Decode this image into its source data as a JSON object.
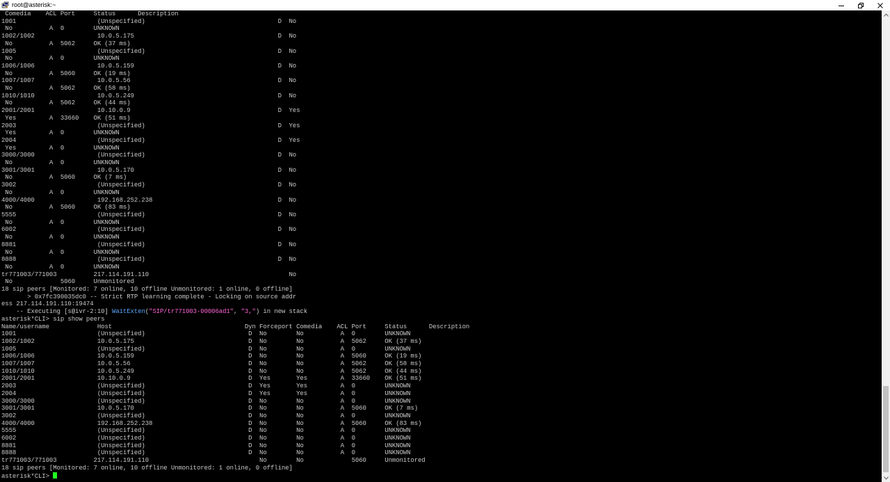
{
  "window": {
    "title": "root@asterisk:~",
    "icon": "putty-terminal-icon",
    "minimize_icon": "minimize-icon",
    "maximize_icon": "restore-icon",
    "close_icon": "close-icon"
  },
  "colors": {
    "background": "#000000",
    "text": "#c8c8c8",
    "application": "#5aa8ff",
    "string": "#ff66d6",
    "cursor": "#22ff22"
  },
  "terminal": {
    "lines": [
      " Comedia    ACL Port     Status      Description",
      "1001                      (Unspecified)                                    D  No",
      " No          A  0        UNKNOWN",
      "1002/1002                 10.0.5.175                                       D  No",
      " No          A  5062     OK (37 ms)",
      "1005                      (Unspecified)                                    D  No",
      " No          A  0        UNKNOWN",
      "1006/1006                 10.0.5.159                                       D  No",
      " No          A  5060     OK (19 ms)",
      "1007/1007                 10.0.5.56                                        D  No",
      " No          A  5062     OK (58 ms)",
      "1010/1010                 10.0.5.249                                       D  No",
      " No          A  5062     OK (44 ms)",
      "2001/2001                 10.10.0.9                                        D  Yes",
      " Yes         A  33660    OK (51 ms)",
      "2003                      (Unspecified)                                    D  Yes",
      " Yes         A  0        UNKNOWN",
      "2004                      (Unspecified)                                    D  Yes",
      " Yes         A  0        UNKNOWN",
      "3000/3000                 (Unspecified)                                    D  No",
      " No          A  0        UNKNOWN",
      "3001/3001                 10.0.5.170                                       D  No",
      " No          A  5060     OK (7 ms)",
      "3002                      (Unspecified)                                    D  No",
      " No          A  0        UNKNOWN",
      "4000/4000                 192.168.252.238                                  D  No",
      " No          A  5060     OK (83 ms)",
      "5555                      (Unspecified)                                    D  No",
      " No          A  0        UNKNOWN",
      "6002                      (Unspecified)                                    D  No",
      " No          A  0        UNKNOWN",
      "8881                      (Unspecified)                                    D  No",
      " No          A  0        UNKNOWN",
      "8888                      (Unspecified)                                    D  No",
      " No          A  0        UNKNOWN",
      "tr771003/771003          217.114.191.110                                      No",
      " No             5060     Unmonitored",
      "18 sip peers [Monitored: 7 online, 10 offline Unmonitored: 1 online, 0 offline]",
      "       > 0x7fc390035dc0 -- Strict RTP learning complete - Locking on source addr",
      "ess 217.114.191.110:19474",
      "    -- Executing [s@ivr-2:10] ",
      "asterisk*CLI> sip show peers",
      "Name/username             Host                                    Dyn Forceport Comedia    ACL Port     Status      Description",
      "1001                      (Unspecified)                            D  No        No          A  0        UNKNOWN",
      "1002/1002                 10.0.5.175                               D  No        No          A  5062     OK (37 ms)",
      "1005                      (Unspecified)                            D  No        No          A  0        UNKNOWN",
      "1006/1006                 10.0.5.159                               D  No        No          A  5060     OK (19 ms)",
      "1007/1007                 10.0.5.56                                D  No        No          A  5062     OK (58 ms)",
      "1010/1010                 10.0.5.249                               D  No        No          A  5062     OK (44 ms)",
      "2001/2001                 10.10.0.9                                D  Yes       Yes         A  33660    OK (51 ms)",
      "2003                      (Unspecified)                            D  Yes       Yes         A  0        UNKNOWN",
      "2004                      (Unspecified)                            D  Yes       Yes         A  0        UNKNOWN",
      "3000/3000                 (Unspecified)                            D  No        No          A  0        UNKNOWN",
      "3001/3001                 10.0.5.170                               D  No        No          A  5060     OK (7 ms)",
      "3002                      (Unspecified)                            D  No        No          A  0        UNKNOWN",
      "4000/4000                 192.168.252.238                          D  No        No          A  5060     OK (83 ms)",
      "5555                      (Unspecified)                            D  No        No          A  0        UNKNOWN",
      "6002                      (Unspecified)                            D  No        No          A  0        UNKNOWN",
      "8881                      (Unspecified)                            D  No        No          A  0        UNKNOWN",
      "8888                      (Unspecified)                            D  No        No          A  0        UNKNOWN",
      "tr771003/771003          217.114.191.110                              No        No             5060     Unmonitored",
      "18 sip peers [Monitored: 7 online, 10 offline Unmonitored: 1 online, 0 offline]"
    ],
    "exec_app": "WaitExten",
    "exec_open": "(",
    "exec_arg1": "\"SIP/tr771003-00006ad1\"",
    "exec_mid": ", ",
    "exec_arg2": "\"3,\"",
    "exec_close": ") in new stack",
    "prompt": "asterisk*CLI> "
  }
}
